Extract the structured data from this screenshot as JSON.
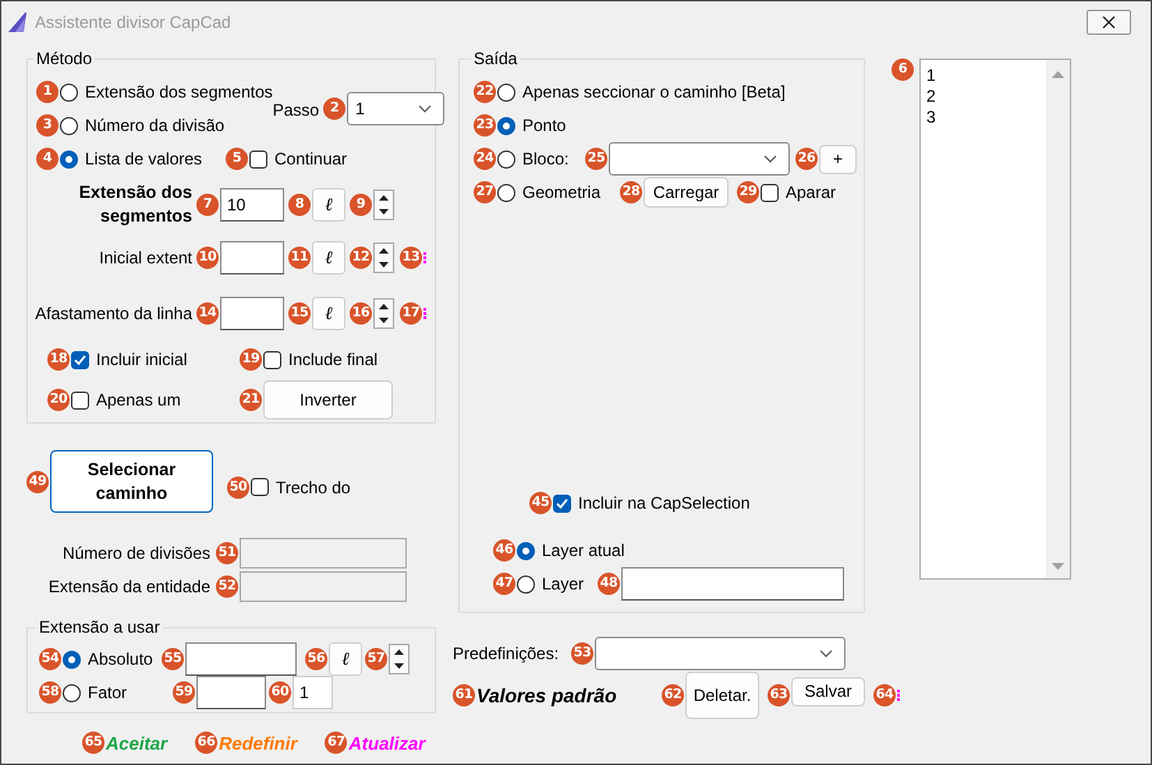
{
  "window": {
    "title": "Assistente divisor CapCad"
  },
  "metodo": {
    "title": "Método",
    "options": [
      {
        "label": "Extensão dos segmentos",
        "selected": false,
        "badge": "1"
      },
      {
        "label": "Número da divisão",
        "selected": false,
        "badge": "3"
      },
      {
        "label": "Lista de valores",
        "selected": true,
        "badge": "4"
      }
    ],
    "passo": {
      "label": "Passo",
      "value": "1",
      "badge": "2"
    },
    "continuar": {
      "label": "Continuar",
      "checked": false,
      "badge": "5"
    },
    "fields": [
      {
        "label": "Extensão dos segmentos",
        "bold": true,
        "value": "10",
        "field_badge": "7",
        "unit": "ℓ",
        "unit_badge": "8",
        "spinner_badge": "9"
      },
      {
        "label": "Inicial extent",
        "bold": false,
        "field_badge": "10",
        "unit": "ℓ",
        "unit_badge": "11",
        "spinner_badge": "12",
        "mark": {
          "badge": "13"
        }
      },
      {
        "label": "Afastamento da linha",
        "bold": false,
        "field_badge": "14",
        "unit": "ℓ",
        "unit_badge": "15",
        "spinner_badge": "16",
        "mark": {
          "badge": "17"
        }
      }
    ],
    "incluir_inicial": {
      "label": "Incluir inicial",
      "checked": true,
      "badge": "18"
    },
    "include_final": {
      "label": "Include final",
      "checked": false,
      "badge": "19"
    },
    "apenas_um": {
      "label": "Apenas um",
      "checked": false,
      "badge": "20"
    },
    "inverter": {
      "label": "Inverter",
      "badge": "21"
    }
  },
  "selecionar": {
    "label": "Selecionar caminho",
    "badge": "49"
  },
  "trecho": {
    "label": "Trecho do",
    "checked": false,
    "badge": "50"
  },
  "info": [
    {
      "label": "Número de divisões",
      "badge": "51"
    },
    {
      "label": "Extensão da entidade",
      "badge": "52"
    }
  ],
  "extensao": {
    "title": "Extensão a usar",
    "absoluto": {
      "label": "Absoluto",
      "selected": true,
      "badge": "54",
      "field_badge": "55",
      "unit": "ℓ",
      "unit_badge": "56",
      "spinner_badge": "57"
    },
    "fator": {
      "label": "Fator",
      "selected": false,
      "badge": "58",
      "field_badge": "59",
      "value": "1",
      "value_badge": "60"
    }
  },
  "links": [
    {
      "label": "Aceitar",
      "color": "#1fa64a",
      "badge": "65"
    },
    {
      "label": "Redefinir",
      "color": "#ff7a00",
      "badge": "66"
    },
    {
      "label": "Atualizar",
      "color": "#ff00ff",
      "badge": "67"
    }
  ],
  "saida": {
    "title": "Saída",
    "options": [
      {
        "label": "Apenas seccionar o caminho [Beta]",
        "selected": false,
        "badge": "22"
      },
      {
        "label": "Ponto",
        "selected": true,
        "badge": "23"
      },
      {
        "label": "Bloco:",
        "selected": false,
        "badge": "24"
      },
      {
        "label": "Geometria",
        "selected": false,
        "badge": "27"
      }
    ],
    "bloco_combo": {
      "badge": "25"
    },
    "add_button": {
      "label": "+",
      "badge": "26"
    },
    "carregar": {
      "label": "Carregar",
      "badge": "28"
    },
    "aparar": {
      "label": "Aparar",
      "checked": false,
      "badge": "29"
    },
    "capselection": {
      "label": "Incluir na CapSelection",
      "checked": true,
      "badge": "45"
    },
    "layers": [
      {
        "label": "Layer atual",
        "selected": true,
        "badge": "46"
      },
      {
        "label": "Layer",
        "selected": false,
        "badge": "47"
      }
    ],
    "layer_field": {
      "badge": "48"
    }
  },
  "presets": {
    "label": "Predefinições:",
    "badge": "53",
    "defaults": {
      "label": "Valores padrão",
      "badge": "61"
    },
    "delete": {
      "label": "Deletar.",
      "badge": "62"
    },
    "save": {
      "label": "Salvar",
      "badge": "63"
    },
    "mark": {
      "badge": "64"
    }
  },
  "list": {
    "badge": "6",
    "items": [
      "1",
      "2",
      "3"
    ]
  }
}
